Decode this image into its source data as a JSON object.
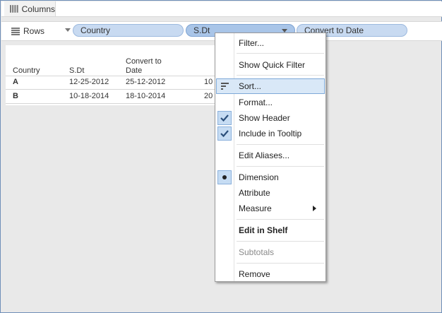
{
  "shelves": {
    "columns_label": "Columns",
    "rows_label": "Rows",
    "pills": [
      "Country",
      "S.Dt",
      "Convert to Date"
    ]
  },
  "table": {
    "headers": [
      "Country",
      "S.Dt",
      "Convert to Date"
    ],
    "rows": [
      {
        "country": "A",
        "sdt": "12-25-2012",
        "converted": "25-12-2012",
        "partial": "10"
      },
      {
        "country": "B",
        "sdt": "10-18-2014",
        "converted": "18-10-2014",
        "partial": "20"
      }
    ]
  },
  "context_menu": {
    "items": [
      "Filter...",
      "Show Quick Filter",
      "Sort...",
      "Format...",
      "Show Header",
      "Include in Tooltip",
      "Edit Aliases...",
      "Dimension",
      "Attribute",
      "Measure",
      "Edit in Shelf",
      "Subtotals",
      "Remove"
    ]
  },
  "colors": {
    "pill": "#c8daf1",
    "pill_border": "#9cb9de",
    "menu_highlight": "#d9e8f7",
    "check_bg": "#c6dcf3"
  },
  "icons": [
    "columns-shelf-icon",
    "rows-shelf-icon",
    "sort-icon",
    "checkmark-icon",
    "radio-dot-icon",
    "submenu-arrow-icon"
  ]
}
